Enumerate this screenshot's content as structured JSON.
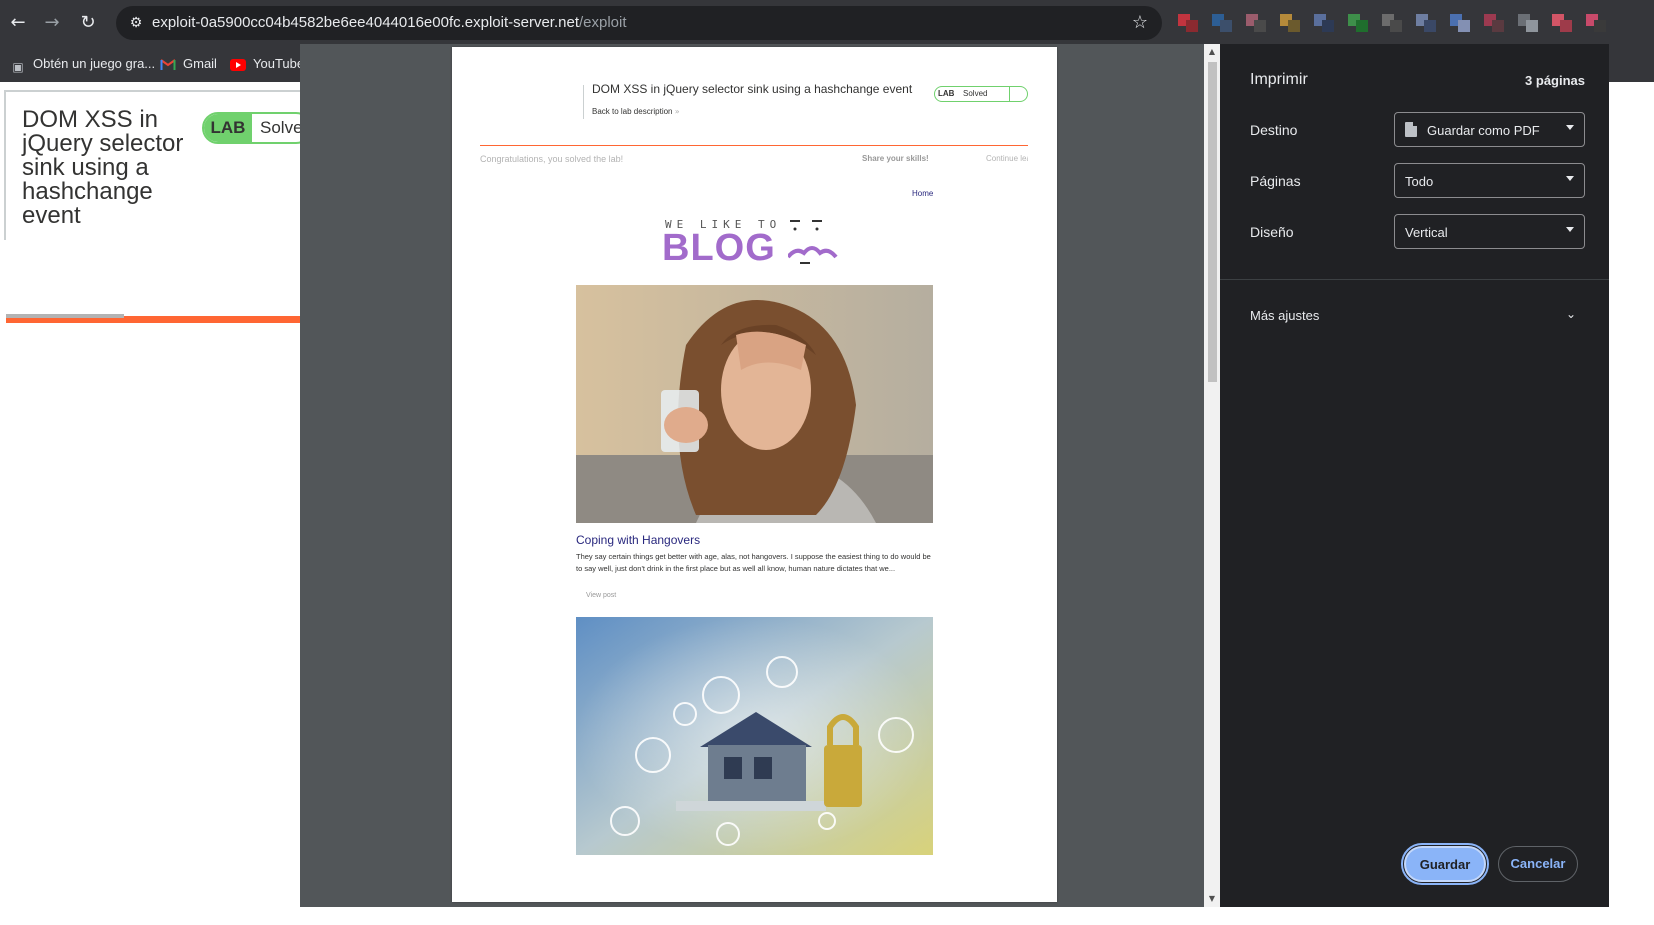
{
  "browser": {
    "url_host": "exploit-0a5900cc04b4582be6ee4044016e00fc.exploit-server.net",
    "url_path": "/exploit",
    "back_icon": "back-arrow-icon",
    "forward_icon": "forward-arrow-icon",
    "reload_icon": "reload-icon",
    "bookmark_star_icon": "star-icon",
    "extension_colors": [
      [
        "#c2343f",
        "#8a2a30"
      ],
      [
        "#2d5e94",
        "#3c4f6b"
      ],
      [
        "#9b5c6c",
        "#4a4a4a"
      ],
      [
        "#b58a3a",
        "#6b5a2d"
      ],
      [
        "#5a6f9c",
        "#2d3a55"
      ],
      [
        "#3e8f4a",
        "#1f6e2d"
      ],
      [
        "#6c6c6c",
        "#4a4a4a"
      ],
      [
        "#6e7ea1",
        "#3a4866"
      ],
      [
        "#4b70b0",
        "#8390b3"
      ],
      [
        "#9c3a50",
        "#5a3a40"
      ],
      [
        "#6b6f75",
        "#8f959c"
      ],
      [
        "#d25566",
        "#9e3b4a"
      ],
      [
        "#c84a6a",
        "#3a3a3a"
      ]
    ]
  },
  "bookmarks": [
    {
      "label": "Obtén un juego gra...",
      "icon": "game-icon"
    },
    {
      "label": "Gmail",
      "icon": "gmail-icon"
    },
    {
      "label": "YouTube",
      "icon": "youtube-icon"
    }
  ],
  "background_page": {
    "title": "DOM XSS in jQuery selector sink using a hashchange event",
    "lab_badge": "LAB",
    "status": "Solved"
  },
  "print_preview": {
    "header_title": "DOM XSS in jQuery selector sink using a hashchange event",
    "back_link": "Back to lab description",
    "lab_badge": "LAB",
    "status": "Solved",
    "congrats": "Congratulations, you solved the lab!",
    "share": "Share your skills!",
    "continue": "Continue learning",
    "home_link": "Home",
    "logo_top": "WE LIKE TO",
    "logo_main": "BLOG",
    "post": {
      "title": "Coping with Hangovers",
      "text": "They say certain things get better with age, alas, not hangovers. I suppose the easiest thing to do would be to say well, just don't drink in the first place but as well all know, human nature dictates that we...",
      "view_post": "View post"
    }
  },
  "print_panel": {
    "title": "Imprimir",
    "pages_count": "3 páginas",
    "destination_label": "Destino",
    "destination_value": "Guardar como PDF",
    "pages_label": "Páginas",
    "pages_value": "Todo",
    "layout_label": "Diseño",
    "layout_value": "Vertical",
    "more_settings": "Más ajustes",
    "save_button": "Guardar",
    "cancel_button": "Cancelar"
  }
}
